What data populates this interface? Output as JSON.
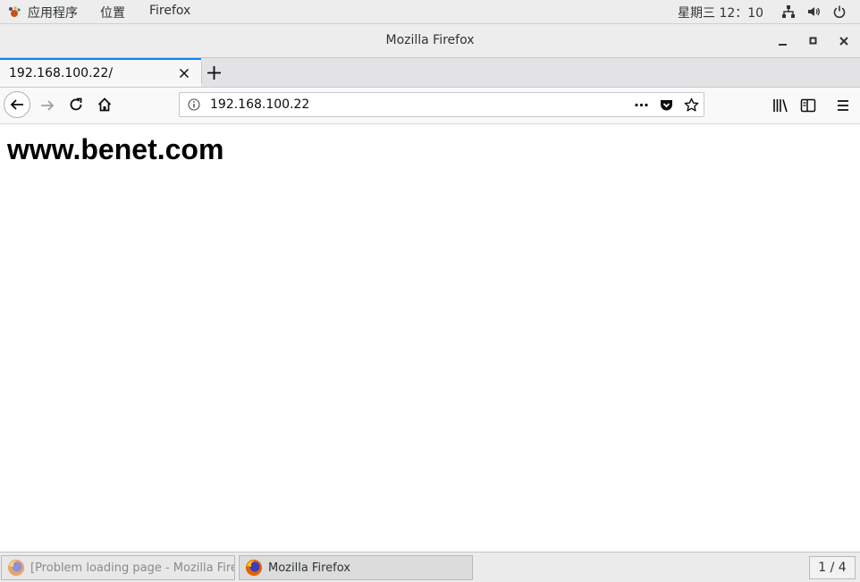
{
  "topbar": {
    "apps_label": "应用程序",
    "places_label": "位置",
    "app_label": "Firefox",
    "clock": "星期三 12：10"
  },
  "window": {
    "title": "Mozilla Firefox"
  },
  "tabs": [
    {
      "title": "192.168.100.22/",
      "active": true
    }
  ],
  "navbar": {
    "url": "192.168.100.22"
  },
  "page": {
    "heading": "www.benet.com"
  },
  "taskbar": {
    "tasks": [
      {
        "label": "[Problem loading page - Mozilla Fire…",
        "active": false
      },
      {
        "label": "Mozilla Firefox",
        "active": true
      }
    ],
    "workspace": "1 / 4"
  },
  "colors": {
    "accent": "#0a84ff",
    "chrome_bg": "#ededed",
    "toolbar_bg": "#f9f9fa"
  }
}
